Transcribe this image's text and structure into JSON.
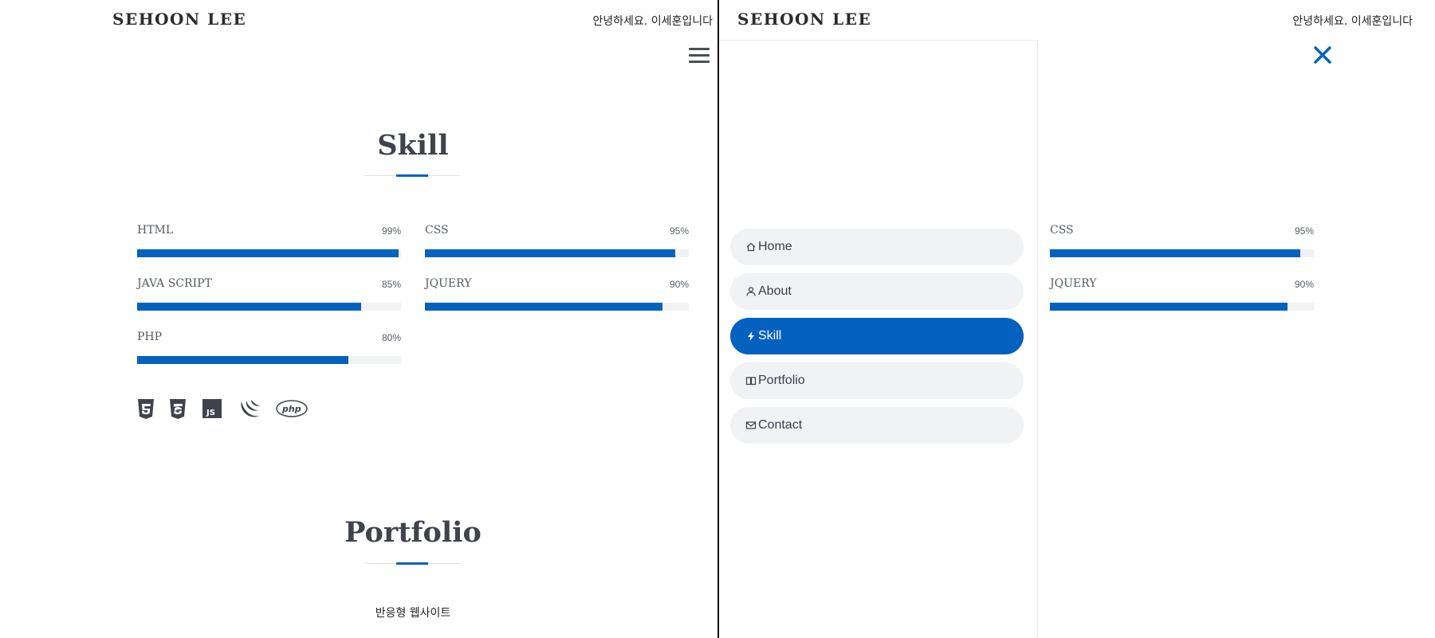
{
  "header": {
    "brand": "SEHOON LEE",
    "greeting": "안녕하세요. 이세훈입니다"
  },
  "skill_section": {
    "title": "Skill",
    "skills": [
      {
        "name": "HTML",
        "percent_label": "99%",
        "value": 99
      },
      {
        "name": "CSS",
        "percent_label": "95%",
        "value": 95
      },
      {
        "name": "JAVA SCRIPT",
        "percent_label": "85%",
        "value": 85
      },
      {
        "name": "JQUERY",
        "percent_label": "90%",
        "value": 90
      },
      {
        "name": "PHP",
        "percent_label": "80%",
        "value": 80
      }
    ],
    "tech_icons": [
      "html5-icon",
      "css3-icon",
      "javascript-icon",
      "jquery-icon",
      "php-icon"
    ]
  },
  "portfolio_section": {
    "title": "Portfolio",
    "subtitle": "반응형 웹사이트"
  },
  "nav_drawer": {
    "items": [
      {
        "label": "Home",
        "icon": "home-icon",
        "active": false
      },
      {
        "label": "About",
        "icon": "user-icon",
        "active": false
      },
      {
        "label": "Skill",
        "icon": "lightning-icon",
        "active": true
      },
      {
        "label": "Portfolio",
        "icon": "book-icon",
        "active": false
      },
      {
        "label": "Contact",
        "icon": "mail-icon",
        "active": false
      }
    ]
  },
  "colors": {
    "accent": "#0461bf",
    "heading": "#3f444c",
    "track": "#f1f2f4"
  }
}
